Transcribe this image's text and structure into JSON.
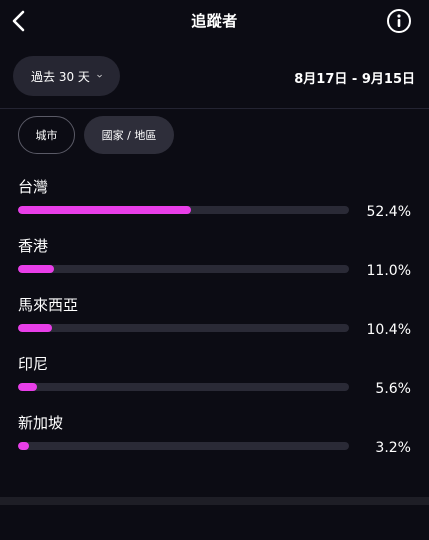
{
  "header": {
    "title": "追蹤者",
    "back_icon": "chevron-left-icon",
    "info_icon": "info-icon"
  },
  "filter": {
    "period_label": "過去 30 天",
    "date_range": "8月17日 - 9月15日"
  },
  "tabs": [
    {
      "label": "城市",
      "selected": false
    },
    {
      "label": "國家 / 地區",
      "selected": true
    }
  ],
  "regions": [
    {
      "name": "台灣",
      "percent_label": "52.4%",
      "fraction": 0.524
    },
    {
      "name": "香港",
      "percent_label": "11.0%",
      "fraction": 0.11
    },
    {
      "name": "馬來西亞",
      "percent_label": "10.4%",
      "fraction": 0.104
    },
    {
      "name": "印尼",
      "percent_label": "5.6%",
      "fraction": 0.056
    },
    {
      "name": "新加坡",
      "percent_label": "3.2%",
      "fraction": 0.032
    }
  ],
  "colors": {
    "background": "#0c0c14",
    "bar_fill": "#e83ee8",
    "bar_track": "#2a2a36"
  }
}
